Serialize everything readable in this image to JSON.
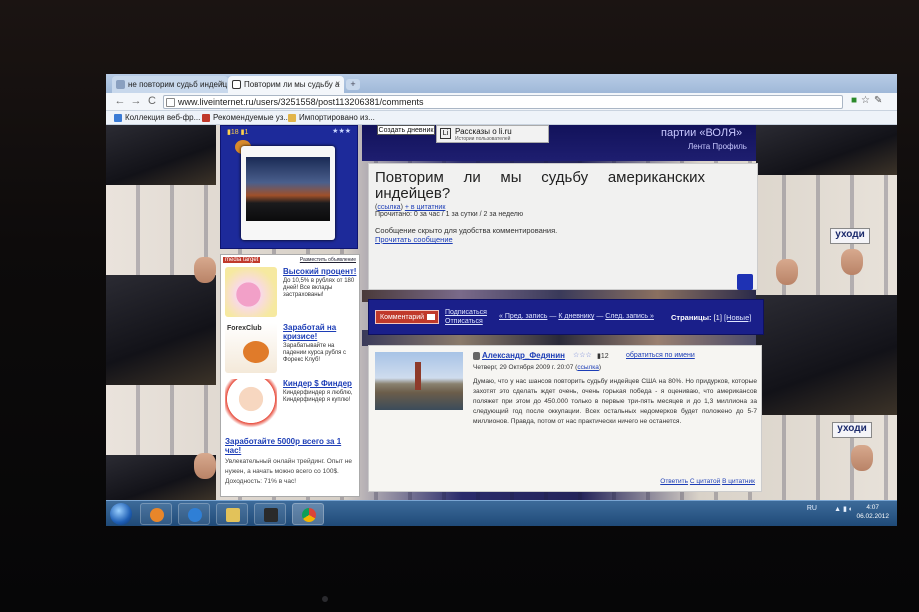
{
  "browser": {
    "tabs": [
      {
        "title": "не повторим судьб индейц",
        "active": false
      },
      {
        "title": "Повторим ли мы судьбу а",
        "active": true
      }
    ],
    "new_tab": "+",
    "url": "www.liveinternet.ru/users/3251558/post113206381/comments",
    "nav": {
      "back": "←",
      "forward": "→",
      "reload": "C"
    },
    "bookmarks": [
      "Коллекция веб-фр...",
      "Рекомендуемые уз...",
      "Импортировано из..."
    ]
  },
  "header": {
    "create_diary": "Создать дневник",
    "li_title": "Рассказы о li.ru",
    "li_subtitle": "Истории пользователей",
    "party": "партии «ВОЛЯ»",
    "profile_feed": "Лента Профиль"
  },
  "profile": {
    "count_posts": "18",
    "count_other": "1",
    "stars": "★★★"
  },
  "signs": [
    "уходи",
    "уходи"
  ],
  "ads": {
    "brand": "media target",
    "place": "Разместить объявление",
    "items": [
      {
        "title": "Высокий процент!",
        "body": "До 10,5% в рублях от 180 дней! Все вклады застрахованы!"
      },
      {
        "title": "Заработай на кризисе!",
        "body": "Зарабатывайте на падении курса рубля с Форекс Клуб!",
        "img_label": "ForexClub"
      },
      {
        "title": "Киндер $ Финдер",
        "body": "Киндерфиндер я люблю, Киндерфиндер я куплю!"
      },
      {
        "title": "Заработайте 5000р всего за 1 час!",
        "body": "Увлекательный онлайн трейдинг. Опыт не нужен, а начать можно всего со 100$. Доходность: 71% в час!"
      }
    ]
  },
  "post": {
    "title": "Повторим ли мы судьбу американских индейцев?",
    "link": "ссылка",
    "quote": "+ в цитатник",
    "read_stats": "Прочитано: 0 за час / 1 за сутки / 2 за неделю",
    "hidden_note": "Сообщение скрыто для удобства комментирования.",
    "read_link": "Прочитать сообщение"
  },
  "action_bar": {
    "comment_btn": "Комментарий",
    "subscribe": "Подписаться",
    "unsubscribe": "Отписаться",
    "prev": "« Пред. запись",
    "sep1": "—",
    "to_diary": "К дневнику",
    "sep2": "—",
    "next": "След. запись »",
    "pages_label": "Страницы:",
    "page_current": "[1]",
    "page_new": "[Новые]"
  },
  "comment": {
    "author": "Александр_Федянин",
    "stars": "☆☆☆",
    "count": "12",
    "reply_by_name": "обратиться по имени",
    "date": "Четверг, 29 Октября 2009 г. 20:07",
    "link": "ссылка",
    "text": "Думаю, что у нас шансов повторить судьбу индейцев США на 80%. Но придурков, которые захотят это сделать ждет очень, очень горькая победа - я оцениваю, что американсов поляжет при этом до 450.000 только в первые три-пять месяцев и до 1,3 миллиона за следующий год после оккупации. Всех остальных недомерков будет положено до 5-7 миллионов. Правда, потом от нас практически ничего не останется.",
    "reply": "Ответить",
    "reply_quote": "С цитатой",
    "to_quotebook": "В цитатник"
  },
  "taskbar": {
    "lang": "RU",
    "time": "4:07",
    "date": "06.02.2012"
  },
  "colors": {
    "link": "#1c3db6",
    "blue_panel": "#1a1f8a",
    "ad_red": "#c0392b"
  }
}
